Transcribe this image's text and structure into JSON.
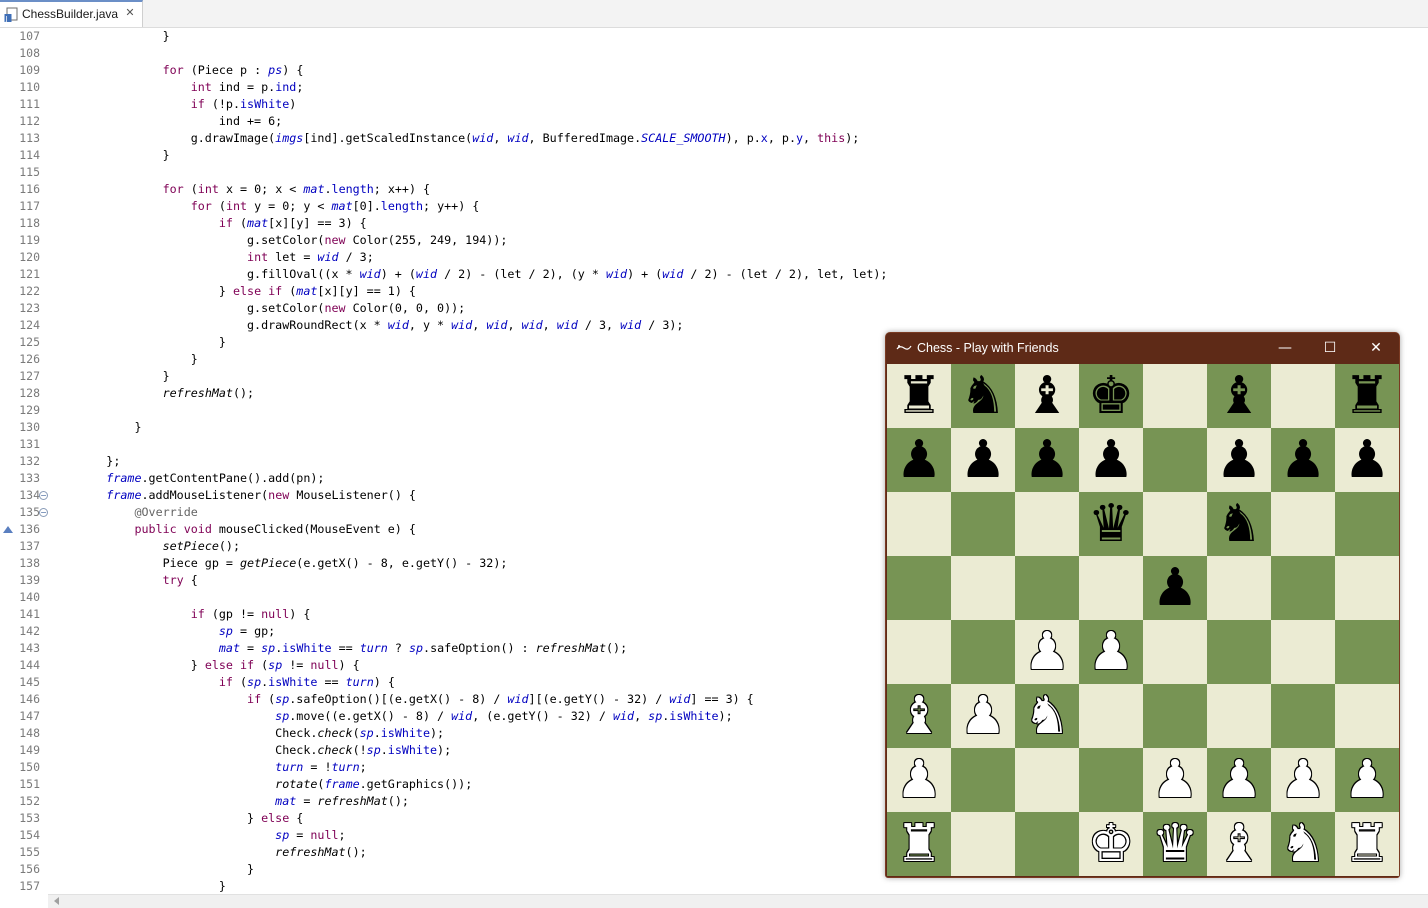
{
  "editor": {
    "tab_title": "ChessBuilder.java",
    "tab_close": "✕",
    "lines": [
      {
        "n": "107",
        "html": "                }"
      },
      {
        "n": "108",
        "html": ""
      },
      {
        "n": "109",
        "html": "                <span class=\"kw\">for</span> (Piece p : <span class=\"fld ital\">ps</span>) {"
      },
      {
        "n": "110",
        "html": "                    <span class=\"kw\">int</span> ind = p.<span class=\"fld\">ind</span>;"
      },
      {
        "n": "111",
        "html": "                    <span class=\"kw\">if</span> (!p.<span class=\"fld\">isWhite</span>)"
      },
      {
        "n": "112",
        "html": "                        ind += 6;"
      },
      {
        "n": "113",
        "html": "                    g.drawImage(<span class=\"fld ital\">imgs</span>[ind].getScaledInstance(<span class=\"fld ital\">wid</span>, <span class=\"fld ital\">wid</span>, BufferedImage.<span class=\"sfld\">SCALE_SMOOTH</span>), p.<span class=\"fld\">x</span>, p.<span class=\"fld\">y</span>, <span class=\"kw\">this</span>);"
      },
      {
        "n": "114",
        "html": "                }"
      },
      {
        "n": "115",
        "html": ""
      },
      {
        "n": "116",
        "html": "                <span class=\"kw\">for</span> (<span class=\"kw\">int</span> x = 0; x &lt; <span class=\"fld ital\">mat</span>.<span class=\"fld\">length</span>; x++) {"
      },
      {
        "n": "117",
        "html": "                    <span class=\"kw\">for</span> (<span class=\"kw\">int</span> y = 0; y &lt; <span class=\"fld ital\">mat</span>[0].<span class=\"fld\">length</span>; y++) {"
      },
      {
        "n": "118",
        "html": "                        <span class=\"kw\">if</span> (<span class=\"fld ital\">mat</span>[x][y] == 3) {"
      },
      {
        "n": "119",
        "html": "                            g.setColor(<span class=\"kw\">new</span> Color(255, 249, 194));"
      },
      {
        "n": "120",
        "html": "                            <span class=\"kw\">int</span> let = <span class=\"fld ital\">wid</span> / 3;"
      },
      {
        "n": "121",
        "html": "                            g.fillOval((x * <span class=\"fld ital\">wid</span>) + (<span class=\"fld ital\">wid</span> / 2) - (let / 2), (y * <span class=\"fld ital\">wid</span>) + (<span class=\"fld ital\">wid</span> / 2) - (let / 2), let, let);"
      },
      {
        "n": "122",
        "html": "                        } <span class=\"kw\">else if</span> (<span class=\"fld ital\">mat</span>[x][y] == 1) {"
      },
      {
        "n": "123",
        "html": "                            g.setColor(<span class=\"kw\">new</span> Color(0, 0, 0));"
      },
      {
        "n": "124",
        "html": "                            g.drawRoundRect(x * <span class=\"fld ital\">wid</span>, y * <span class=\"fld ital\">wid</span>, <span class=\"fld ital\">wid</span>, <span class=\"fld ital\">wid</span>, <span class=\"fld ital\">wid</span> / 3, <span class=\"fld ital\">wid</span> / 3);"
      },
      {
        "n": "125",
        "html": "                        }"
      },
      {
        "n": "126",
        "html": "                    }"
      },
      {
        "n": "127",
        "html": "                }"
      },
      {
        "n": "128",
        "html": "                <span class=\"ital\">refreshMat</span>();"
      },
      {
        "n": "129",
        "html": ""
      },
      {
        "n": "130",
        "html": "            }"
      },
      {
        "n": "131",
        "html": ""
      },
      {
        "n": "132",
        "html": "        };"
      },
      {
        "n": "133",
        "html": "        <span class=\"fld ital\">frame</span>.getContentPane().add(pn);"
      },
      {
        "n": "134",
        "html": "        <span class=\"fld ital\">frame</span>.addMouseListener(<span class=\"kw\">new</span> MouseListener() {"
      },
      {
        "n": "135",
        "html": "            <span class=\"ann\">@Override</span>"
      },
      {
        "n": "136",
        "html": "            <span class=\"kw\">public void</span> mouseClicked(MouseEvent e) {"
      },
      {
        "n": "137",
        "html": "                <span class=\"ital\">setPiece</span>();"
      },
      {
        "n": "138",
        "html": "                Piece gp = <span class=\"ital\">getPiece</span>(e.getX() - 8, e.getY() - 32);"
      },
      {
        "n": "139",
        "html": "                <span class=\"kw\">try</span> {"
      },
      {
        "n": "140",
        "html": ""
      },
      {
        "n": "141",
        "html": "                    <span class=\"kw\">if</span> (gp != <span class=\"kw\">null</span>) {"
      },
      {
        "n": "142",
        "html": "                        <span class=\"fld ital\">sp</span> = gp;"
      },
      {
        "n": "143",
        "html": "                        <span class=\"fld ital\">mat</span> = <span class=\"fld ital\">sp</span>.<span class=\"fld\">isWhite</span> == <span class=\"fld ital\">turn</span> ? <span class=\"fld ital\">sp</span>.safeOption() : <span class=\"ital\">refreshMat</span>();"
      },
      {
        "n": "144",
        "html": "                    } <span class=\"kw\">else if</span> (<span class=\"fld ital\">sp</span> != <span class=\"kw\">null</span>) {"
      },
      {
        "n": "145",
        "html": "                        <span class=\"kw\">if</span> (<span class=\"fld ital\">sp</span>.<span class=\"fld\">isWhite</span> == <span class=\"fld ital\">turn</span>) {"
      },
      {
        "n": "146",
        "html": "                            <span class=\"kw\">if</span> (<span class=\"fld ital\">sp</span>.safeOption()[(e.getX() - 8) / <span class=\"fld ital\">wid</span>][(e.getY() - 32) / <span class=\"fld ital\">wid</span>] == 3) {"
      },
      {
        "n": "147",
        "html": "                                <span class=\"fld ital\">sp</span>.move((e.getX() - 8) / <span class=\"fld ital\">wid</span>, (e.getY() - 32) / <span class=\"fld ital\">wid</span>, <span class=\"fld ital\">sp</span>.<span class=\"fld\">isWhite</span>);"
      },
      {
        "n": "148",
        "html": "                                Check.<span class=\"ital\">check</span>(<span class=\"fld ital\">sp</span>.<span class=\"fld\">isWhite</span>);"
      },
      {
        "n": "149",
        "html": "                                Check.<span class=\"ital\">check</span>(!<span class=\"fld ital\">sp</span>.<span class=\"fld\">isWhite</span>);"
      },
      {
        "n": "150",
        "html": "                                <span class=\"fld ital\">turn</span> = !<span class=\"fld ital\">turn</span>;"
      },
      {
        "n": "151",
        "html": "                                <span class=\"ital\">rotate</span>(<span class=\"fld ital\">frame</span>.getGraphics());"
      },
      {
        "n": "152",
        "html": "                                <span class=\"fld ital\">mat</span> = <span class=\"ital\">refreshMat</span>();"
      },
      {
        "n": "153",
        "html": "                            } <span class=\"kw\">else</span> {"
      },
      {
        "n": "154",
        "html": "                                <span class=\"fld ital\">sp</span> = <span class=\"kw\">null</span>;"
      },
      {
        "n": "155",
        "html": "                                <span class=\"ital\">refreshMat</span>();"
      },
      {
        "n": "156",
        "html": "                            }"
      },
      {
        "n": "157",
        "html": "                        }"
      }
    ]
  },
  "chess_window": {
    "title": "Chess - Play with Friends",
    "minimize": "—",
    "maximize": "☐",
    "close": "✕",
    "colors": {
      "light": "#ebebd3",
      "dark": "#779454",
      "titlebar": "#5e2a17"
    },
    "board": [
      [
        "bR",
        "bN",
        "bB",
        "bK",
        "",
        "bB",
        "",
        "bR"
      ],
      [
        "bP",
        "bP",
        "bP",
        "bP",
        "",
        "bP",
        "bP",
        "bP"
      ],
      [
        "",
        "",
        "",
        "bQ",
        "",
        "bN",
        "",
        ""
      ],
      [
        "",
        "",
        "",
        "",
        "bP",
        "",
        "",
        ""
      ],
      [
        "",
        "",
        "wP",
        "wP",
        "",
        "",
        "",
        ""
      ],
      [
        "wB",
        "wP",
        "wN",
        "",
        "",
        "",
        "",
        ""
      ],
      [
        "wP",
        "",
        "",
        "",
        "wP",
        "wP",
        "wP",
        "wP"
      ],
      [
        "wR",
        "",
        "",
        "wK",
        "wQ",
        "wB",
        "wN",
        "wR"
      ]
    ]
  }
}
